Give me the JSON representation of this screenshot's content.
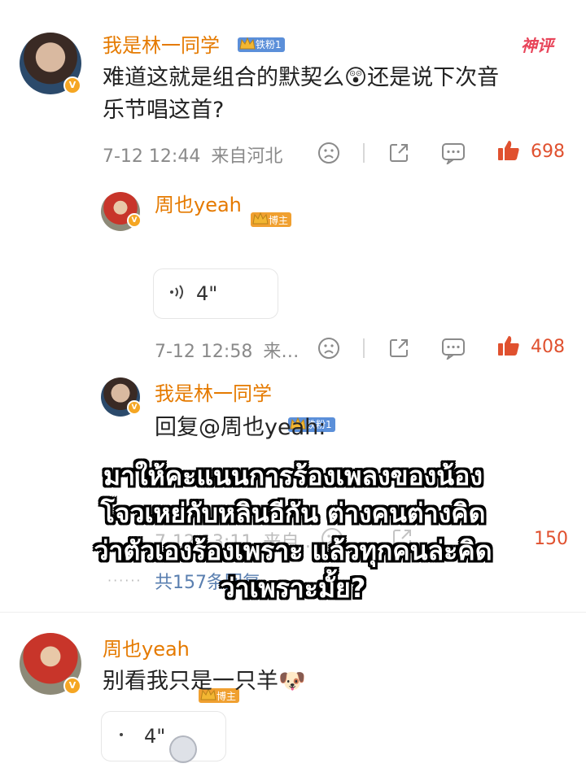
{
  "comments": [
    {
      "user": "我是林一同学",
      "fan_badge": "铁粉1",
      "hot_tag": "神评",
      "text_line1": "难道这就是组合的默契么😲还是说下次音",
      "text_line2": "乐节唱这首?",
      "time": "7-12 12:44",
      "location": "来自河北",
      "likes": "698"
    },
    {
      "user": "周也yeah",
      "role_badge": "博主",
      "voice_duration": "4\"",
      "time": "7-12 12:58",
      "location": "来…",
      "likes": "408"
    },
    {
      "user": "我是林一同学",
      "fan_badge": "铁粉1",
      "reply_text": "回复@周也yeah:",
      "time": "7-12 13:11",
      "location": "来自…",
      "likes": "150",
      "more_replies": "共157条回复"
    },
    {
      "user": "周也yeah",
      "role_badge": "博主",
      "text": "别看我只是一只羊🐶",
      "voice_duration": "4\""
    }
  ],
  "caption": {
    "line1": "มาให้คะแนนการร้องเพลงของน้อง",
    "line2": "โจวเหย่กับหลินอีกัน ต่างคนต่างคิด",
    "line3": "ว่าตัวเองร้องเพราะ แล้วทุกคนล่ะคิด",
    "line4": "ว่าเพราะมั้ย?"
  },
  "colors": {
    "name": "#e57a00",
    "like": "#e0512f",
    "hot_tag": "#e8455a",
    "fan_badge": "#5b8fd9",
    "role_badge": "#f0a030"
  },
  "icons": [
    "sad-face-icon",
    "share-icon",
    "comment-icon",
    "thumbs-up-icon",
    "voice-wave-icon",
    "verified-v-icon",
    "crown-icon"
  ]
}
